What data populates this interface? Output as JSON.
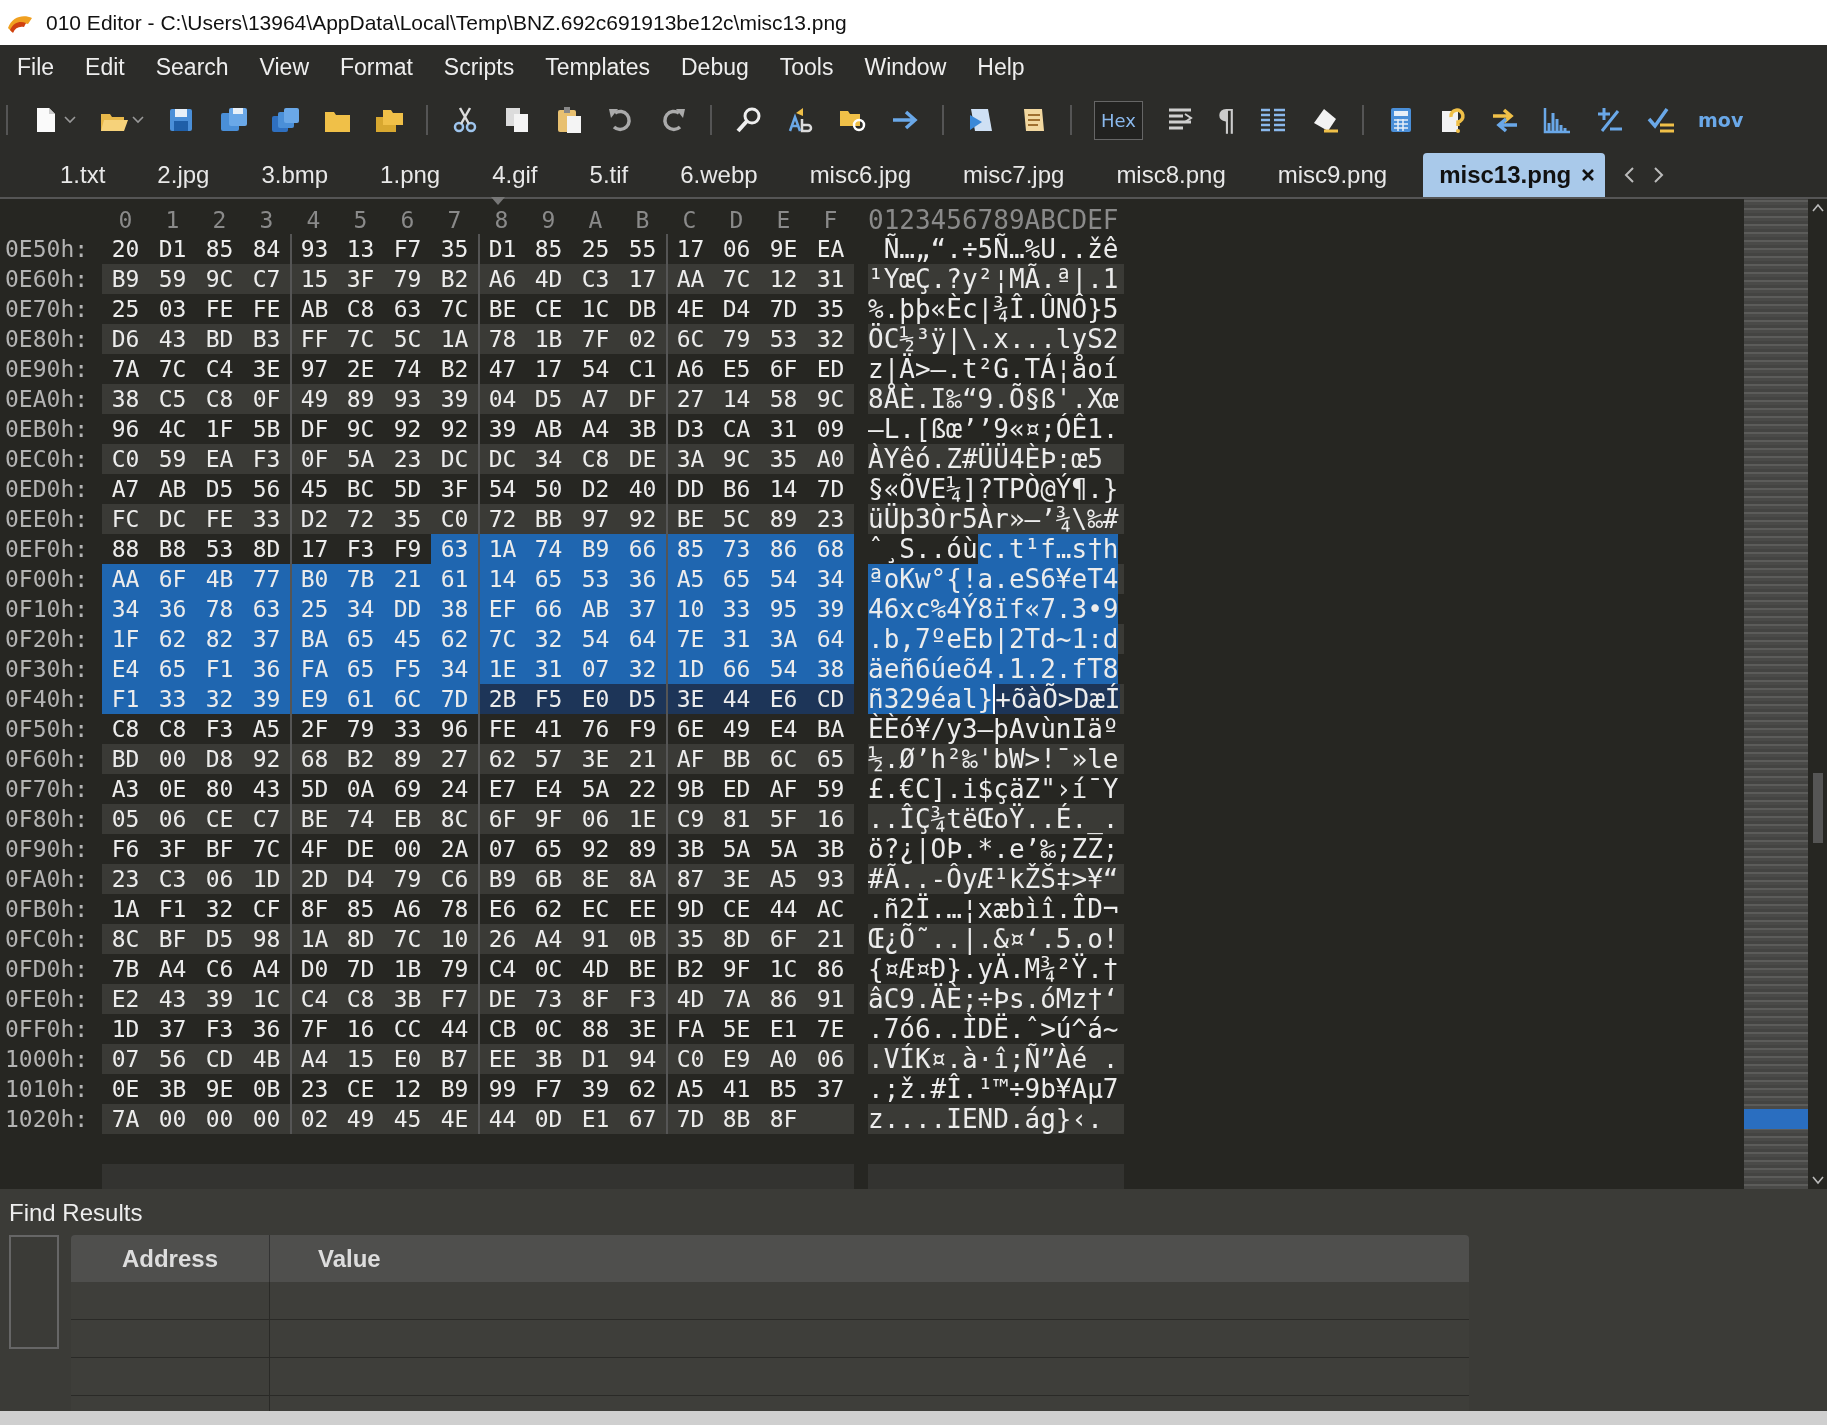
{
  "window": {
    "title": "010 Editor - C:\\Users\\13964\\AppData\\Local\\Temp\\BNZ.692c691913be12c\\misc13.png"
  },
  "menu": [
    "File",
    "Edit",
    "Search",
    "View",
    "Format",
    "Scripts",
    "Templates",
    "Debug",
    "Tools",
    "Window",
    "Help"
  ],
  "toolbar": {
    "hex": {
      "label": "Hex",
      "on": true
    },
    "pilcrow": "¶",
    "mov": "mov"
  },
  "tabs": [
    {
      "label": "1.txt",
      "selected": false
    },
    {
      "label": "2.jpg",
      "selected": false
    },
    {
      "label": "3.bmp",
      "selected": false
    },
    {
      "label": "1.png",
      "selected": false
    },
    {
      "label": "4.gif",
      "selected": false
    },
    {
      "label": "5.tif",
      "selected": false
    },
    {
      "label": "6.webp",
      "selected": false
    },
    {
      "label": "misc6.jpg",
      "selected": false
    },
    {
      "label": "misc7.jpg",
      "selected": false
    },
    {
      "label": "misc8.png",
      "selected": false
    },
    {
      "label": "misc9.png",
      "selected": false
    },
    {
      "label": "misc13.png",
      "selected": true
    }
  ],
  "hex_view": {
    "column_headers": [
      "0",
      "1",
      "2",
      "3",
      "4",
      "5",
      "6",
      "7",
      "8",
      "9",
      "A",
      "B",
      "C",
      "D",
      "E",
      "F"
    ],
    "ascii_header": "0123456789ABCDEF",
    "rows": [
      {
        "address": "0E50h:",
        "segments": [
          {
            "kind": "plain",
            "bytes": [
              "20",
              "D1",
              "85",
              "84",
              "93",
              "13",
              "F7",
              "35",
              "D1",
              "85",
              "25",
              "55",
              "17",
              "06",
              "9E",
              "EA"
            ],
            "text": " Ñ…„“.÷5Ñ…%U..žê"
          }
        ]
      },
      {
        "address": "0E60h:",
        "segments": [
          {
            "kind": "plain",
            "bytes": [
              "B9",
              "59",
              "9C",
              "C7",
              "15",
              "3F",
              "79",
              "B2",
              "A6",
              "4D",
              "C3",
              "17",
              "AA",
              "7C",
              "12",
              "31"
            ],
            "text": "¹YœÇ.?y²¦MÃ.ª|.1"
          }
        ]
      },
      {
        "address": "0E70h:",
        "segments": [
          {
            "kind": "plain",
            "bytes": [
              "25",
              "03",
              "FE",
              "FE",
              "AB",
              "C8",
              "63",
              "7C",
              "BE",
              "CE",
              "1C",
              "DB",
              "4E",
              "D4",
              "7D",
              "35"
            ],
            "text": "%.þþ«Èc|¾Î.ÛNÔ}5"
          }
        ]
      },
      {
        "address": "0E80h:",
        "segments": [
          {
            "kind": "plain",
            "bytes": [
              "D6",
              "43",
              "BD",
              "B3",
              "FF",
              "7C",
              "5C",
              "1A",
              "78",
              "1B",
              "7F",
              "02",
              "6C",
              "79",
              "53",
              "32"
            ],
            "text": "ÖC½³ÿ|\\.x...lyS2"
          }
        ]
      },
      {
        "address": "0E90h:",
        "segments": [
          {
            "kind": "plain",
            "bytes": [
              "7A",
              "7C",
              "C4",
              "3E",
              "97",
              "2E",
              "74",
              "B2",
              "47",
              "17",
              "54",
              "C1",
              "A6",
              "E5",
              "6F",
              "ED"
            ],
            "text": "z|Ä>—.t²G.TÁ¦åoí"
          }
        ]
      },
      {
        "address": "0EA0h:",
        "segments": [
          {
            "kind": "plain",
            "bytes": [
              "38",
              "C5",
              "C8",
              "0F",
              "49",
              "89",
              "93",
              "39",
              "04",
              "D5",
              "A7",
              "DF",
              "27",
              "14",
              "58",
              "9C"
            ],
            "text": "8ÅÈ.I‰“9.Õ§ß'.Xœ"
          }
        ]
      },
      {
        "address": "0EB0h:",
        "segments": [
          {
            "kind": "plain",
            "bytes": [
              "96",
              "4C",
              "1F",
              "5B",
              "DF",
              "9C",
              "92",
              "92",
              "39",
              "AB",
              "A4",
              "3B",
              "D3",
              "CA",
              "31",
              "09"
            ],
            "text": "–L.[ßœ’’9«¤;ÓÊ1."
          }
        ]
      },
      {
        "address": "0EC0h:",
        "segments": [
          {
            "kind": "plain",
            "bytes": [
              "C0",
              "59",
              "EA",
              "F3",
              "0F",
              "5A",
              "23",
              "DC",
              "DC",
              "34",
              "C8",
              "DE",
              "3A",
              "9C",
              "35",
              "A0"
            ],
            "text": "ÀYêó.Z#ÜÜ4ÈÞ:œ5"
          }
        ]
      },
      {
        "address": "0ED0h:",
        "segments": [
          {
            "kind": "plain",
            "bytes": [
              "A7",
              "AB",
              "D5",
              "56",
              "45",
              "BC",
              "5D",
              "3F",
              "54",
              "50",
              "D2",
              "40",
              "DD",
              "B6",
              "14",
              "7D"
            ],
            "text": "§«ÕVE¼]?TPÒ@Ý¶.}"
          }
        ]
      },
      {
        "address": "0EE0h:",
        "segments": [
          {
            "kind": "plain",
            "bytes": [
              "FC",
              "DC",
              "FE",
              "33",
              "D2",
              "72",
              "35",
              "C0",
              "72",
              "BB",
              "97",
              "92",
              "BE",
              "5C",
              "89",
              "23"
            ],
            "text": "üÜþ3Òr5Àr»—’¾\\‰#"
          }
        ]
      },
      {
        "address": "0EF0h:",
        "segments": [
          {
            "kind": "plain",
            "bytes": [
              "88",
              "B8",
              "53",
              "8D",
              "17",
              "F3",
              "F9"
            ],
            "text": "ˆ¸S..óù"
          },
          {
            "kind": "selected",
            "bytes": [
              "63",
              "1A",
              "74",
              "B9",
              "66",
              "85",
              "73",
              "86",
              "68"
            ],
            "text": "c.t¹f…s†h"
          }
        ]
      },
      {
        "address": "0F00h:",
        "segments": [
          {
            "kind": "selected",
            "bytes": [
              "AA",
              "6F",
              "4B",
              "77",
              "B0",
              "7B",
              "21",
              "61",
              "14",
              "65",
              "53",
              "36",
              "A5",
              "65",
              "54",
              "34"
            ],
            "text": "ªoKw°{!a.eS6¥eT4"
          }
        ]
      },
      {
        "address": "0F10h:",
        "segments": [
          {
            "kind": "selected",
            "bytes": [
              "34",
              "36",
              "78",
              "63",
              "25",
              "34",
              "DD",
              "38",
              "EF",
              "66",
              "AB",
              "37",
              "10",
              "33",
              "95",
              "39"
            ],
            "text": "46xc%4Ý8ïf«7.3•9"
          }
        ]
      },
      {
        "address": "0F20h:",
        "segments": [
          {
            "kind": "selected",
            "bytes": [
              "1F",
              "62",
              "82",
              "37",
              "BA",
              "65",
              "45",
              "62",
              "7C",
              "32",
              "54",
              "64",
              "7E",
              "31",
              "3A",
              "64"
            ],
            "text": ".b‚7ºeEb|2Td~1:d"
          }
        ]
      },
      {
        "address": "0F30h:",
        "segments": [
          {
            "kind": "selected",
            "bytes": [
              "E4",
              "65",
              "F1",
              "36",
              "FA",
              "65",
              "F5",
              "34",
              "1E",
              "31",
              "07",
              "32",
              "1D",
              "66",
              "54",
              "38"
            ],
            "text": "äeñ6úeõ4.1.2.fT8"
          }
        ]
      },
      {
        "address": "0F40h:",
        "segments": [
          {
            "kind": "selected",
            "bytes": [
              "F1",
              "33",
              "32",
              "39",
              "E9",
              "61",
              "6C",
              "7D"
            ],
            "text": "ñ329éal}"
          },
          {
            "kind": "marked",
            "bytes": [
              "2B",
              "F5",
              "E0",
              "D5",
              "3E",
              "44",
              "E6",
              "CD"
            ],
            "text": "+õàÕ>DæÍ"
          }
        ]
      },
      {
        "address": "0F50h:",
        "segments": [
          {
            "kind": "plain",
            "bytes": [
              "C8",
              "C8",
              "F3",
              "A5",
              "2F",
              "79",
              "33",
              "96",
              "FE",
              "41",
              "76",
              "F9",
              "6E",
              "49",
              "E4",
              "BA"
            ],
            "text": "ÈÈó¥/y3–þAvùnIäº"
          }
        ]
      },
      {
        "address": "0F60h:",
        "segments": [
          {
            "kind": "plain",
            "bytes": [
              "BD",
              "00",
              "D8",
              "92",
              "68",
              "B2",
              "89",
              "27",
              "62",
              "57",
              "3E",
              "21",
              "AF",
              "BB",
              "6C",
              "65"
            ],
            "text": "½.Ø’h²‰'bW>!¯»le"
          }
        ]
      },
      {
        "address": "0F70h:",
        "segments": [
          {
            "kind": "plain",
            "bytes": [
              "A3",
              "0E",
              "80",
              "43",
              "5D",
              "0A",
              "69",
              "24",
              "E7",
              "E4",
              "5A",
              "22",
              "9B",
              "ED",
              "AF",
              "59"
            ],
            "text": "£.€C].i$çäZ\"›í¯Y"
          }
        ]
      },
      {
        "address": "0F80h:",
        "segments": [
          {
            "kind": "plain",
            "bytes": [
              "05",
              "06",
              "CE",
              "C7",
              "BE",
              "74",
              "EB",
              "8C",
              "6F",
              "9F",
              "06",
              "1E",
              "C9",
              "81",
              "5F",
              "16"
            ],
            "text": "..ÎÇ¾tëŒoŸ..É._."
          }
        ]
      },
      {
        "address": "0F90h:",
        "segments": [
          {
            "kind": "plain",
            "bytes": [
              "F6",
              "3F",
              "BF",
              "7C",
              "4F",
              "DE",
              "00",
              "2A",
              "07",
              "65",
              "92",
              "89",
              "3B",
              "5A",
              "5A",
              "3B"
            ],
            "text": "ö?¿|OÞ.*.e’‰;ZZ;"
          }
        ]
      },
      {
        "address": "0FA0h:",
        "segments": [
          {
            "kind": "plain",
            "bytes": [
              "23",
              "C3",
              "06",
              "1D",
              "2D",
              "D4",
              "79",
              "C6",
              "B9",
              "6B",
              "8E",
              "8A",
              "87",
              "3E",
              "A5",
              "93"
            ],
            "text": "#Ã..-ÔyÆ¹kŽŠ‡>¥“"
          }
        ]
      },
      {
        "address": "0FB0h:",
        "segments": [
          {
            "kind": "plain",
            "bytes": [
              "1A",
              "F1",
              "32",
              "CF",
              "8F",
              "85",
              "A6",
              "78",
              "E6",
              "62",
              "EC",
              "EE",
              "9D",
              "CE",
              "44",
              "AC"
            ],
            "text": ".ñ2Ï.…¦xæbìî.ÎD¬"
          }
        ]
      },
      {
        "address": "0FC0h:",
        "segments": [
          {
            "kind": "plain",
            "bytes": [
              "8C",
              "BF",
              "D5",
              "98",
              "1A",
              "8D",
              "7C",
              "10",
              "26",
              "A4",
              "91",
              "0B",
              "35",
              "8D",
              "6F",
              "21"
            ],
            "text": "Œ¿Õ˜..|.&¤‘.5.o!"
          }
        ]
      },
      {
        "address": "0FD0h:",
        "segments": [
          {
            "kind": "plain",
            "bytes": [
              "7B",
              "A4",
              "C6",
              "A4",
              "D0",
              "7D",
              "1B",
              "79",
              "C4",
              "0C",
              "4D",
              "BE",
              "B2",
              "9F",
              "1C",
              "86"
            ],
            "text": "{¤Æ¤Ð}.yÄ.M¾²Ÿ.†"
          }
        ]
      },
      {
        "address": "0FE0h:",
        "segments": [
          {
            "kind": "plain",
            "bytes": [
              "E2",
              "43",
              "39",
              "1C",
              "C4",
              "C8",
              "3B",
              "F7",
              "DE",
              "73",
              "8F",
              "F3",
              "4D",
              "7A",
              "86",
              "91"
            ],
            "text": "âC9.ÄÈ;÷Þs.óMz†‘"
          }
        ]
      },
      {
        "address": "0FF0h:",
        "segments": [
          {
            "kind": "plain",
            "bytes": [
              "1D",
              "37",
              "F3",
              "36",
              "7F",
              "16",
              "CC",
              "44",
              "CB",
              "0C",
              "88",
              "3E",
              "FA",
              "5E",
              "E1",
              "7E"
            ],
            "text": ".7ó6..ÌDË.ˆ>ú^á~"
          }
        ]
      },
      {
        "address": "1000h:",
        "segments": [
          {
            "kind": "plain",
            "bytes": [
              "07",
              "56",
              "CD",
              "4B",
              "A4",
              "15",
              "E0",
              "B7",
              "EE",
              "3B",
              "D1",
              "94",
              "C0",
              "E9",
              "A0",
              "06"
            ],
            "text": ".VÍK¤.à·î;Ñ”Àé ."
          }
        ]
      },
      {
        "address": "1010h:",
        "segments": [
          {
            "kind": "plain",
            "bytes": [
              "0E",
              "3B",
              "9E",
              "0B",
              "23",
              "CE",
              "12",
              "B9",
              "99",
              "F7",
              "39",
              "62",
              "A5",
              "41",
              "B5",
              "37"
            ],
            "text": ".;ž.#Î.¹™÷9b¥Aµ7"
          }
        ]
      },
      {
        "address": "1020h:",
        "segments": [
          {
            "kind": "plain",
            "bytes": [
              "7A",
              "00",
              "00",
              "00",
              "02",
              "49",
              "45",
              "4E",
              "44",
              "0D",
              "E1",
              "67",
              "7D",
              "8B",
              "8F"
            ],
            "text": "z....IEND.ág}‹."
          }
        ]
      }
    ]
  },
  "find_results": {
    "title": "Find Results",
    "columns": [
      "Address",
      "Value"
    ]
  }
}
